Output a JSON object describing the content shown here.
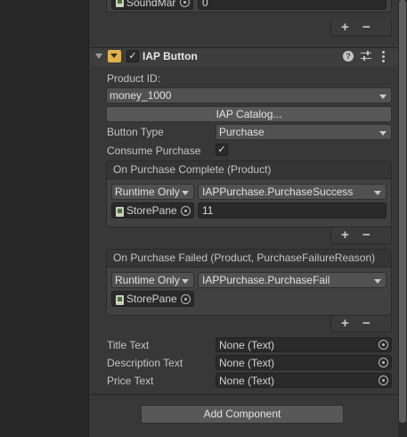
{
  "top_partial": {
    "object_name": "SoundMar",
    "value": "0",
    "add": "+",
    "remove": "−"
  },
  "component": {
    "title": "IAP Button",
    "enabled_check": "✓",
    "product_id_label": "Product ID:",
    "product_id_value": "money_1000",
    "catalog_button": "IAP Catalog...",
    "button_type_label": "Button Type",
    "button_type_value": "Purchase",
    "consume_label": "Consume Purchase",
    "consume_check": "✓"
  },
  "events": [
    {
      "header": "On Purchase Complete (Product)",
      "runtime": "Runtime Only",
      "function": "IAPPurchase.PurchaseSuccess",
      "object": "StorePane",
      "arg": "11",
      "add": "+",
      "remove": "−"
    },
    {
      "header": "On Purchase Failed (Product, PurchaseFailureReason)",
      "runtime": "Runtime Only",
      "function": "IAPPurchase.PurchaseFail",
      "object": "StorePane",
      "add": "+",
      "remove": "−"
    }
  ],
  "text_fields": [
    {
      "label": "Title Text",
      "value": "None (Text)"
    },
    {
      "label": "Description Text",
      "value": "None (Text)"
    },
    {
      "label": "Price Text",
      "value": "None (Text)"
    }
  ],
  "add_component": "Add Component",
  "icons": [
    "foldout-arrow-icon",
    "script-icon",
    "help-icon",
    "presets-icon",
    "more-icon",
    "object-picker-icon"
  ]
}
